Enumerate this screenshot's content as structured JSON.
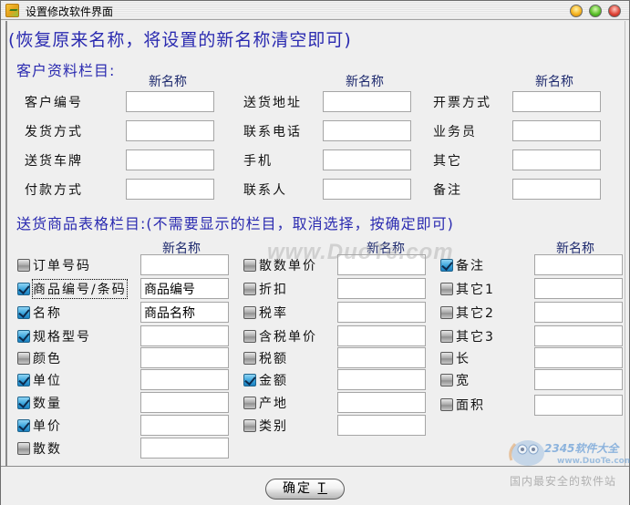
{
  "window": {
    "title": "设置修改软件界面",
    "controls": [
      "minimize",
      "maximize",
      "close"
    ]
  },
  "hint": "(恢复原来名称，将设置的新名称清空即可)",
  "customer_section": {
    "title": "客户资料栏目:",
    "column_header": "新名称",
    "columns": [
      {
        "header": "新名称",
        "rows": [
          {
            "label": "客户编号",
            "value": ""
          },
          {
            "label": "发货方式",
            "value": ""
          },
          {
            "label": "送货车牌",
            "value": ""
          },
          {
            "label": "付款方式",
            "value": ""
          }
        ]
      },
      {
        "header": "新名称",
        "rows": [
          {
            "label": "送货地址",
            "value": ""
          },
          {
            "label": "联系电话",
            "value": ""
          },
          {
            "label": "手机",
            "value": ""
          },
          {
            "label": "联系人",
            "value": ""
          }
        ]
      },
      {
        "header": "新名称",
        "rows": [
          {
            "label": "开票方式",
            "value": ""
          },
          {
            "label": "业务员",
            "value": ""
          },
          {
            "label": "其它",
            "value": ""
          },
          {
            "label": "备注",
            "value": ""
          }
        ]
      }
    ]
  },
  "goods_section": {
    "title": "送货商品表格栏目:(不需要显示的栏目，取消选择，按确定即可)",
    "columns": [
      {
        "header": "新名称",
        "rows": [
          {
            "label": "订单号码",
            "checked": false,
            "value": ""
          },
          {
            "label": "商品编号/条码",
            "checked": true,
            "value": "商品编号",
            "focused": true
          },
          {
            "label": "名称",
            "checked": true,
            "value": "商品名称"
          },
          {
            "label": "规格型号",
            "checked": true,
            "value": ""
          },
          {
            "label": "颜色",
            "checked": false,
            "value": ""
          },
          {
            "label": "单位",
            "checked": true,
            "value": ""
          },
          {
            "label": "数量",
            "checked": true,
            "value": ""
          },
          {
            "label": "单价",
            "checked": true,
            "value": ""
          },
          {
            "label": "散数",
            "checked": false,
            "value": ""
          }
        ]
      },
      {
        "header": "新名称",
        "rows": [
          {
            "label": "散数单价",
            "checked": false,
            "value": ""
          },
          {
            "label": "折扣",
            "checked": false,
            "value": ""
          },
          {
            "label": "税率",
            "checked": false,
            "value": ""
          },
          {
            "label": "含税单价",
            "checked": false,
            "value": ""
          },
          {
            "label": "税额",
            "checked": false,
            "value": ""
          },
          {
            "label": "金额",
            "checked": true,
            "value": ""
          },
          {
            "label": "产地",
            "checked": false,
            "value": ""
          },
          {
            "label": "类别",
            "checked": false,
            "value": ""
          }
        ]
      },
      {
        "header": "新名称",
        "rows": [
          {
            "label": "备注",
            "checked": true,
            "value": ""
          },
          {
            "label": "其它1",
            "checked": false,
            "value": ""
          },
          {
            "label": "其它2",
            "checked": false,
            "value": ""
          },
          {
            "label": "其它3",
            "checked": false,
            "value": ""
          },
          {
            "label": "长",
            "checked": false,
            "value": ""
          },
          {
            "label": "宽",
            "checked": false,
            "value": ""
          },
          {
            "label": "面积",
            "checked": false,
            "value": ""
          }
        ]
      }
    ]
  },
  "footer": {
    "ok_label": "确定",
    "ok_hotkey": "T"
  },
  "watermarks": {
    "center": "www.DuoTe.com",
    "brand": "2345软件大全",
    "url": "www.DuoTe.com",
    "slogan": "国内最安全的软件站"
  }
}
